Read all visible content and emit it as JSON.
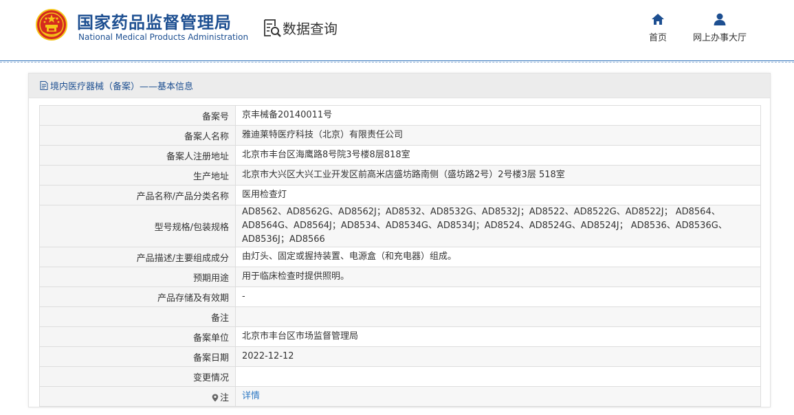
{
  "header": {
    "brand_cn": "国家药品监督管理局",
    "brand_en": "National Medical Products Administration",
    "query_title": "数据查询",
    "nav": {
      "home_label": "首页",
      "service_label": "网上办事大厅"
    }
  },
  "panel": {
    "title": "境内医疗器械（备案）——基本信息"
  },
  "rows": [
    {
      "label": "备案号",
      "value": "京丰械备20140011号"
    },
    {
      "label": "备案人名称",
      "value": "雅迪莱特医疗科技（北京）有限责任公司"
    },
    {
      "label": "备案人注册地址",
      "value": "北京市丰台区海鹰路8号院3号楼8层818室"
    },
    {
      "label": "生产地址",
      "value": "北京市大兴区大兴工业开发区前高米店盛坊路南侧（盛坊路2号）2号楼3层 518室"
    },
    {
      "label": "产品名称/产品分类名称",
      "value": "医用检查灯"
    },
    {
      "label": "型号规格/包装规格",
      "value": "AD8562、AD8562G、AD8562J；AD8532、AD8532G、AD8532J；AD8522、AD8522G、AD8522J； AD8564、AD8564G、AD8564J；AD8534、AD8534G、AD8534J；AD8524、AD8524G、AD8524J； AD8536、AD8536G、AD8536J；AD8566"
    },
    {
      "label": "产品描述/主要组成成分",
      "value": "由灯头、固定或握持装置、电源盒（和充电器）组成。"
    },
    {
      "label": "预期用途",
      "value": "用于临床检查时提供照明。"
    },
    {
      "label": "产品存储及有效期",
      "value": "-"
    },
    {
      "label": "备注",
      "value": ""
    },
    {
      "label": "备案单位",
      "value": "北京市丰台区市场监督管理局"
    },
    {
      "label": "备案日期",
      "value": "2022-12-12"
    },
    {
      "label": "变更情况",
      "value": ""
    },
    {
      "label": "注",
      "value": "详情"
    }
  ],
  "colors": {
    "brand_blue": "#1d4f91",
    "emblem_red": "#d52b1e",
    "emblem_gold": "#f5c518",
    "link_blue": "#2f79c4"
  }
}
